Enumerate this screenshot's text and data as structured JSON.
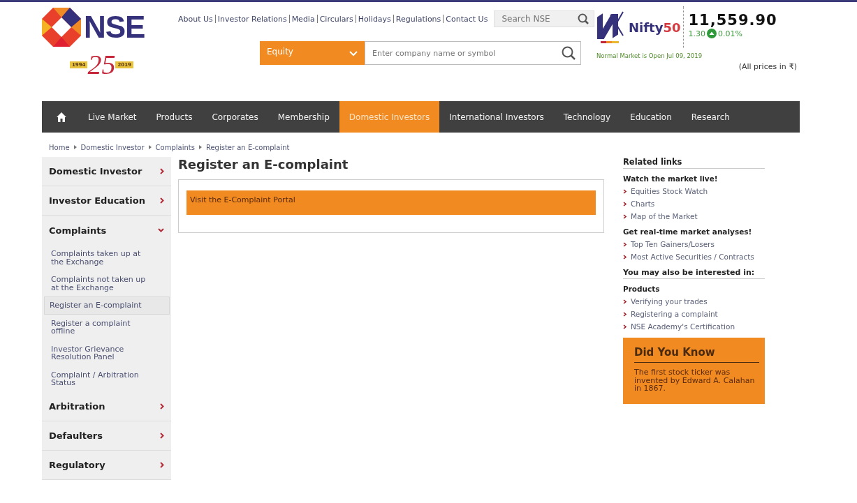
{
  "header": {
    "logo_text": "NSE",
    "anniversary": {
      "number": "25",
      "years": [
        "1994",
        "2019"
      ]
    },
    "top_links": [
      "About Us",
      "Investor Relations",
      "Media",
      "Circulars",
      "Holidays",
      "Regulations",
      "Contact Us"
    ],
    "site_search": {
      "placeholder": "Search NSE"
    },
    "segment": {
      "value": "Equity"
    },
    "symbol_search": {
      "placeholder": "Enter company name or symbol"
    },
    "index": {
      "name": "Nifty",
      "name_number": "50",
      "value": "11,559.90",
      "change": "1.30",
      "percent": "0.01%"
    },
    "market_status": "Normal Market is Open Jul 09, 2019",
    "currency_note": "(All prices in",
    "currency_symbol": "₹)"
  },
  "nav": {
    "tabs": [
      {
        "label": "Live Market",
        "selected": false
      },
      {
        "label": "Products",
        "selected": false
      },
      {
        "label": "Corporates",
        "selected": false
      },
      {
        "label": "Membership",
        "selected": false
      },
      {
        "label": "Domestic Investors",
        "selected": true
      },
      {
        "label": "International Investors",
        "selected": false
      },
      {
        "label": "Technology",
        "selected": false
      },
      {
        "label": "Education",
        "selected": false
      },
      {
        "label": "Research",
        "selected": false
      }
    ]
  },
  "breadcrumb": [
    "Home",
    "Domestic Investor",
    "Complaints",
    "Register an E-complaint"
  ],
  "sidebar": {
    "items": [
      {
        "label": "Domestic Investor",
        "expanded": false
      },
      {
        "label": "Investor Education",
        "expanded": false
      },
      {
        "label": "Complaints",
        "expanded": true,
        "children": [
          {
            "label": "Complaints taken up at the Exchange",
            "selected": false
          },
          {
            "label": "Complaints not taken up at the Exchange",
            "selected": false
          },
          {
            "label": "Register an E-complaint",
            "selected": true
          },
          {
            "label": "Register a complaint offline",
            "selected": false
          },
          {
            "label": "Investor Grievance Resolution Panel",
            "selected": false
          },
          {
            "label": "Complaint / Arbitration Status",
            "selected": false
          }
        ]
      },
      {
        "label": "Arbitration",
        "expanded": false
      },
      {
        "label": "Defaulters",
        "expanded": false
      },
      {
        "label": "Regulatory",
        "expanded": false
      }
    ]
  },
  "main": {
    "title": "Register an E-complaint",
    "portal_link": "Visit the E-Complaint Portal"
  },
  "related": {
    "title": "Related links",
    "groups": [
      {
        "heading": "Watch the market live!",
        "links": [
          "Equities Stock Watch",
          "Charts",
          "Map of the Market"
        ]
      },
      {
        "heading": "Get real-time market analyses!",
        "links": [
          "Top Ten Gainers/Losers",
          "Most Active Securities / Contracts"
        ]
      }
    ],
    "interest_title": "You may also be interested in:",
    "interest_groups": [
      {
        "heading": "Products",
        "links": [
          "Verifying your trades",
          "Registering a complaint",
          "NSE Academy's Certification"
        ]
      }
    ]
  },
  "did_you_know": {
    "title": "Did You Know",
    "text": "The first stock ticker was invented by Edward A. Calahan in 1867."
  }
}
